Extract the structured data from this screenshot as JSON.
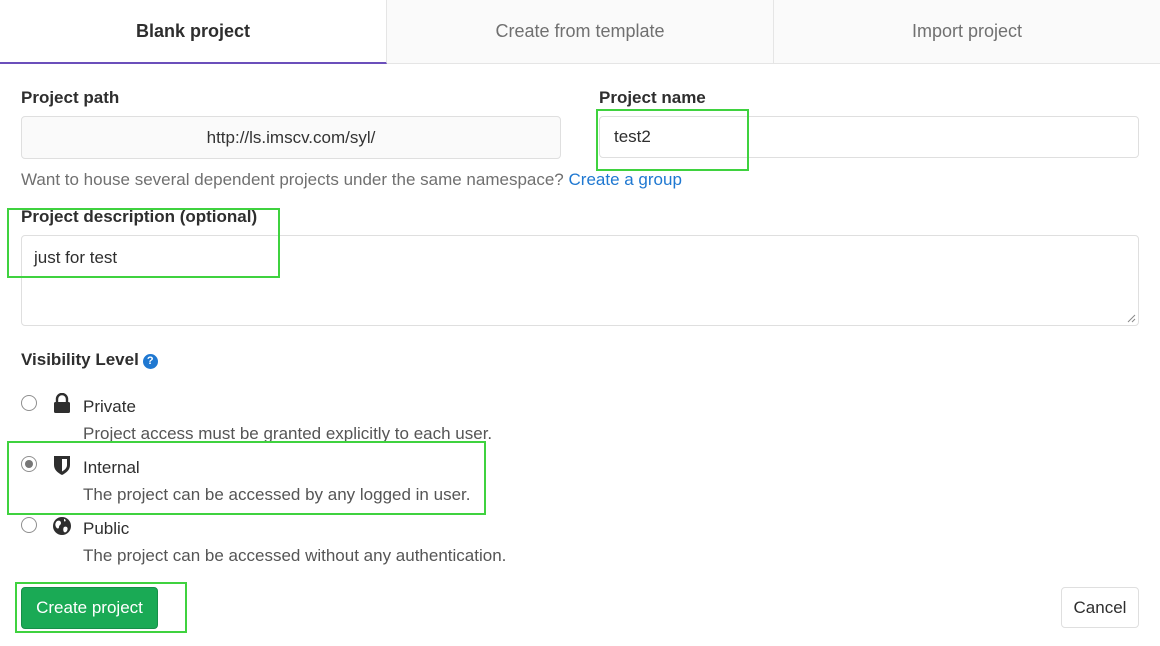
{
  "tabs": [
    {
      "label": "Blank project",
      "active": true
    },
    {
      "label": "Create from template",
      "active": false
    },
    {
      "label": "Import project",
      "active": false
    }
  ],
  "form": {
    "project_path_label": "Project path",
    "project_path_value": "http://ls.imscv.com/syl/",
    "project_name_label": "Project name",
    "project_name_value": "test2",
    "namespace_help": "Want to house several dependent projects under the same namespace?",
    "create_group_link": "Create a group",
    "description_label": "Project description (optional)",
    "description_value": "just for test",
    "visibility_label": "Visibility Level",
    "visibility_help_icon": "question-circle-icon"
  },
  "visibility_options": [
    {
      "title": "Private",
      "description": "Project access must be granted explicitly to each user.",
      "icon": "lock-icon",
      "selected": false
    },
    {
      "title": "Internal",
      "description": "The project can be accessed by any logged in user.",
      "icon": "shield-icon",
      "selected": true
    },
    {
      "title": "Public",
      "description": "The project can be accessed without any authentication.",
      "icon": "globe-icon",
      "selected": false
    }
  ],
  "actions": {
    "create_label": "Create project",
    "cancel_label": "Cancel"
  },
  "colors": {
    "primary_green": "#1aaa55",
    "link_blue": "#1f78d1",
    "tab_underline": "#6b4fbb",
    "highlight_green": "#3fd23f"
  }
}
